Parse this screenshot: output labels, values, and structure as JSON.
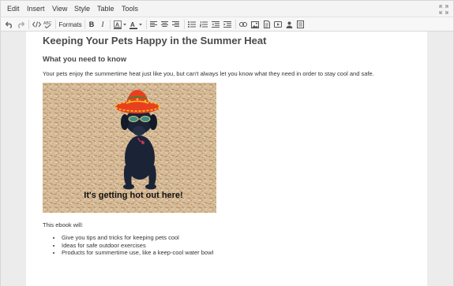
{
  "menubar": {
    "items": [
      "Edit",
      "Insert",
      "View",
      "Style",
      "Table",
      "Tools"
    ]
  },
  "toolbar": {
    "formats_label": "Formats",
    "bold_label": "B",
    "italic_label": "I"
  },
  "document": {
    "title": "Keeping Your Pets Happy in the Summer Heat",
    "subtitle": "What you need to know",
    "paragraph": "Your pets enjoy the summertime heat just like you, but can't always let you know what they need in order to stay cool and safe.",
    "image_caption": "It's getting hot out here!",
    "intro": "This ebook will:",
    "list": [
      "Give you tips and tricks for keeping pets cool",
      "Ideas for safe outdoor exercises",
      "Products for summertime use, like a keep-cool water bowl"
    ]
  }
}
